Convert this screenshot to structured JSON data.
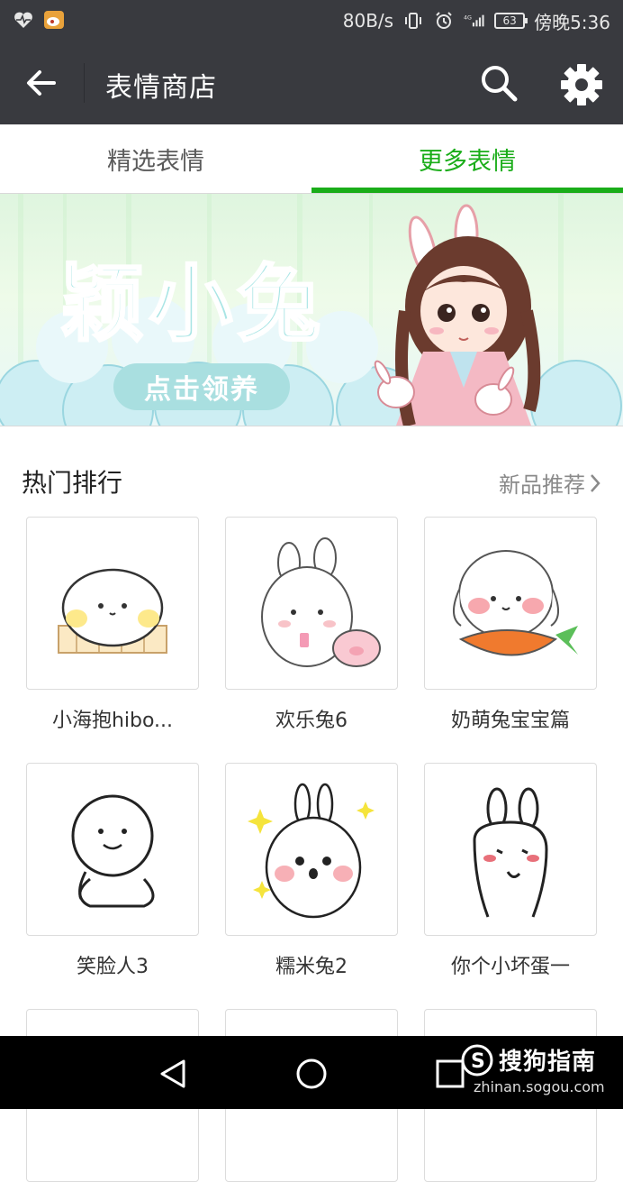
{
  "status_bar": {
    "net_speed": "80B/s",
    "battery": "63",
    "time": "傍晚5:36",
    "signal": "4G"
  },
  "app_bar": {
    "title": "表情商店"
  },
  "tabs": [
    {
      "label": "精选表情",
      "active": false
    },
    {
      "label": "更多表情",
      "active": true
    }
  ],
  "banner": {
    "title": "颖小兔",
    "button_label": "点击领养"
  },
  "hot_section": {
    "title": "热门排行",
    "more_label": "新品推荐"
  },
  "stickers": [
    {
      "name": "小海抱hibo..."
    },
    {
      "name": "欢乐兔6"
    },
    {
      "name": "奶萌兔宝宝篇"
    },
    {
      "name": "笑脸人3"
    },
    {
      "name": "糯米兔2"
    },
    {
      "name": "你个小坏蛋一"
    }
  ],
  "watermark": {
    "brand": "搜狗指南",
    "url": "zhinan.sogou.com"
  },
  "colors": {
    "accent": "#1aad19",
    "app_bar": "#393a3f"
  }
}
